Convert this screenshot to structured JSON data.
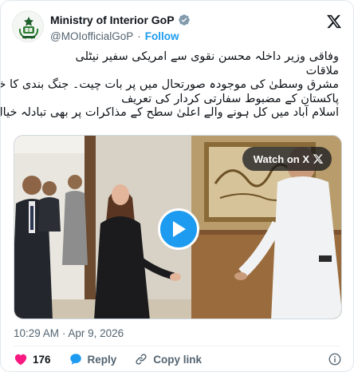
{
  "account": {
    "name": "Ministry of Interior GoP",
    "handle": "@MOIofficialGoP",
    "separator": "·",
    "follow_label": "Follow"
  },
  "tweet": {
    "lines": [
      "وفاقی وزیر داخلہ محسن نقوی سے امریکی سفیر نیٹلی",
      "ملاقات",
      "مشرق وسطیٰ کی موجودہ صورتحال میں پر  بات چیت۔ جنگ بندی کا خیر مقدم",
      "پاکستان کے مضبوط سفارتی کردار کی تعریف",
      "اسلام آباد میں کل ہونے والے اعلیٰ سطح کے مذاکرات پر بھی تبادلہ خیال"
    ]
  },
  "media": {
    "watch_label": "Watch on X",
    "play_icon": "play-icon"
  },
  "timestamp": {
    "time": "10:29 AM",
    "separator": "·",
    "date": "Apr 9, 2026"
  },
  "actions": {
    "like_count": "176",
    "reply_label": "Reply",
    "copy_link_label": "Copy link"
  },
  "colors": {
    "accent": "#1d9bf0",
    "like": "#f91880",
    "secondary_text": "#536471",
    "verified": "#829aab"
  }
}
